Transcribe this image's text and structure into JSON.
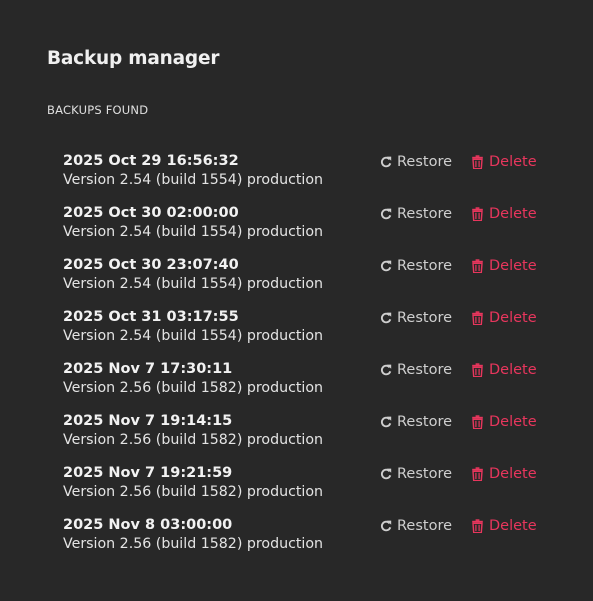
{
  "dialog": {
    "title": "Backup manager",
    "section_label": "BACKUPS FOUND"
  },
  "actions": {
    "restore_label": "Restore",
    "delete_label": "Delete",
    "restore_icon": "refresh-icon",
    "delete_icon": "trash-icon"
  },
  "colors": {
    "background": "#282828",
    "delete_accent": "#e8365d",
    "restore_text": "#cfcfcf"
  },
  "backups": [
    {
      "date": "2025 Oct 29 16:56:32",
      "version": "Version 2.54 (build 1554) production"
    },
    {
      "date": "2025 Oct 30 02:00:00",
      "version": "Version 2.54 (build 1554) production"
    },
    {
      "date": "2025 Oct 30 23:07:40",
      "version": "Version 2.54 (build 1554) production"
    },
    {
      "date": "2025 Oct 31 03:17:55",
      "version": "Version 2.54 (build 1554) production"
    },
    {
      "date": "2025 Nov 7 17:30:11",
      "version": "Version 2.56 (build 1582) production"
    },
    {
      "date": "2025 Nov 7 19:14:15",
      "version": "Version 2.56 (build 1582) production"
    },
    {
      "date": "2025 Nov 7 19:21:59",
      "version": "Version 2.56 (build 1582) production"
    },
    {
      "date": "2025 Nov 8 03:00:00",
      "version": "Version 2.56 (build 1582) production"
    }
  ]
}
